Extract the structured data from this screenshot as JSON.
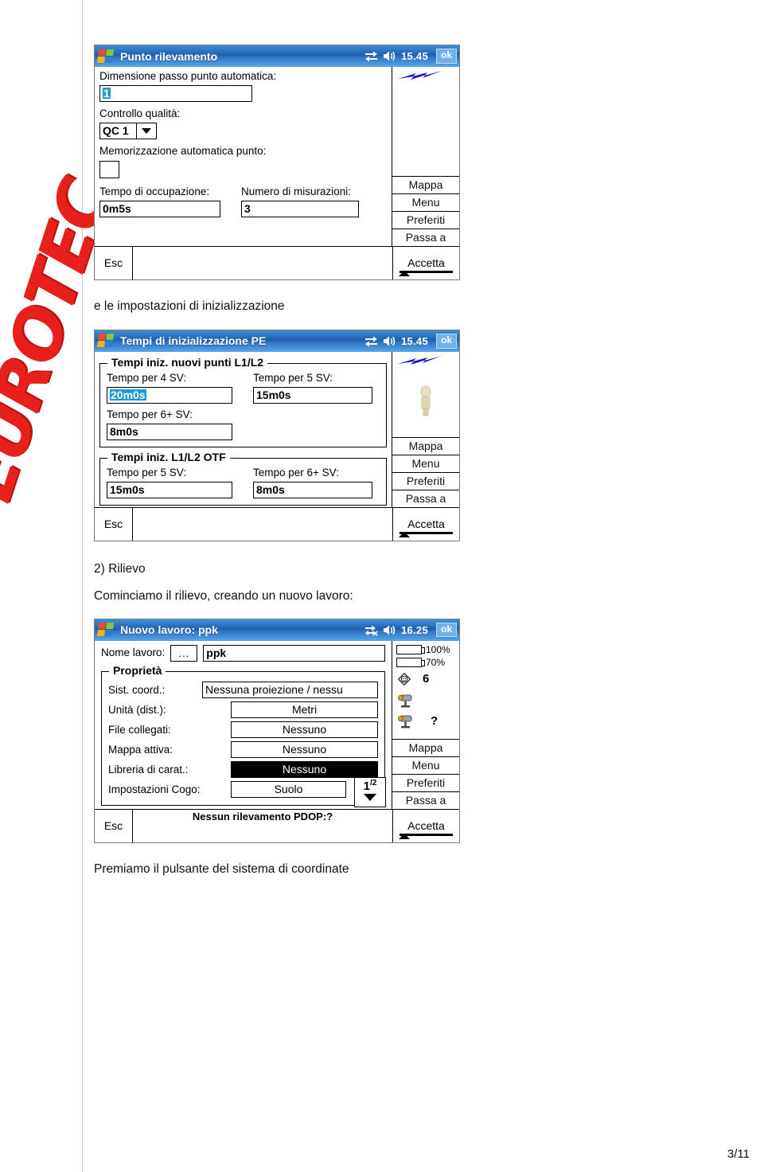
{
  "page": {
    "number": "3/11"
  },
  "watermark": {
    "text": "EUROTEC"
  },
  "texts": {
    "t1": "e le impostazioni di inizializzazione",
    "t2": "2) Rilievo",
    "t3": "Cominciamo il rilievo, creando un nuovo lavoro:",
    "t4": "Premiamo il pulsante del sistema di coordinate"
  },
  "dialog1": {
    "title": "Punto rilevamento",
    "clock": "15.45",
    "ok_label": "ok",
    "fields": {
      "auto_step_label": "Dimensione passo punto automatica:",
      "auto_step_value": "1",
      "quality_label": "Controllo qualità:",
      "quality_value": "QC 1",
      "autostore_label": "Memorizzazione automatica punto:",
      "autostore_checked": "",
      "occupation_label": "Tempo di occupazione:",
      "occupation_value": "0m5s",
      "measurements_label": "Numero di misurazioni:",
      "measurements_value": "3"
    },
    "side_buttons": [
      "Mappa",
      "Menu",
      "Preferiti",
      "Passa a"
    ],
    "esc_label": "Esc",
    "accept_label": "Accetta",
    "status_bar": ""
  },
  "dialog2": {
    "title": "Tempi di inizializzazione PE",
    "clock": "15.45",
    "ok_label": "ok",
    "group1": {
      "title": "Tempi iniz. nuovi punti L1/L2",
      "rows": [
        {
          "label": "Tempo per 4 SV:",
          "value": "20m0s",
          "selected": true
        },
        {
          "label": "Tempo per 5 SV:",
          "value": "15m0s",
          "selected": false
        },
        {
          "label": "Tempo per 6+ SV:",
          "value": "8m0s",
          "selected": false
        }
      ]
    },
    "group2": {
      "title": "Tempi iniz. L1/L2 OTF",
      "rows": [
        {
          "label": "Tempo per 5 SV:",
          "value": "15m0s"
        },
        {
          "label": "Tempo per 6+ SV:",
          "value": "8m0s"
        }
      ]
    },
    "side_buttons": [
      "Mappa",
      "Menu",
      "Preferiti",
      "Passa a"
    ],
    "esc_label": "Esc",
    "accept_label": "Accetta",
    "status_bar": ""
  },
  "dialog3": {
    "title": "Nuovo lavoro: ppk",
    "clock": "16.25",
    "ok_label": "ok",
    "name_label": "Nome lavoro:",
    "browse_label": "...",
    "name_value": "ppk",
    "group_title": "Proprietà",
    "properties": [
      {
        "label": "Sist. coord.:",
        "value": "Nessuna proiezione / nessu",
        "style": "wide"
      },
      {
        "label": "Unità (dist.):",
        "value": "Metri",
        "style": "normal"
      },
      {
        "label": "File collegati:",
        "value": "Nessuno",
        "style": "normal"
      },
      {
        "label": "Mappa attiva:",
        "value": "Nessuno",
        "style": "normal"
      },
      {
        "label": "Libreria di carat.:",
        "value": "Nessuno",
        "style": "inverted"
      },
      {
        "label": "Impostazioni Cogo:",
        "value": "Suolo",
        "style": "normal"
      }
    ],
    "pager": {
      "current": "1",
      "total": "/2"
    },
    "status_icons": {
      "battery1": "100%",
      "battery2": "70%",
      "satellites": "6",
      "receiver_unknown": "?"
    },
    "side_buttons": [
      "Mappa",
      "Menu",
      "Preferiti",
      "Passa a"
    ],
    "esc_label": "Esc",
    "accept_label": "Accetta",
    "status_bar": "Nessun rilevamento  PDOP:?"
  },
  "colors": {
    "titlebar_blue": "#2f74c4",
    "selection": "#1b9ad6",
    "logo_red": "#e8201c",
    "battery_fill": "#1028d8"
  }
}
